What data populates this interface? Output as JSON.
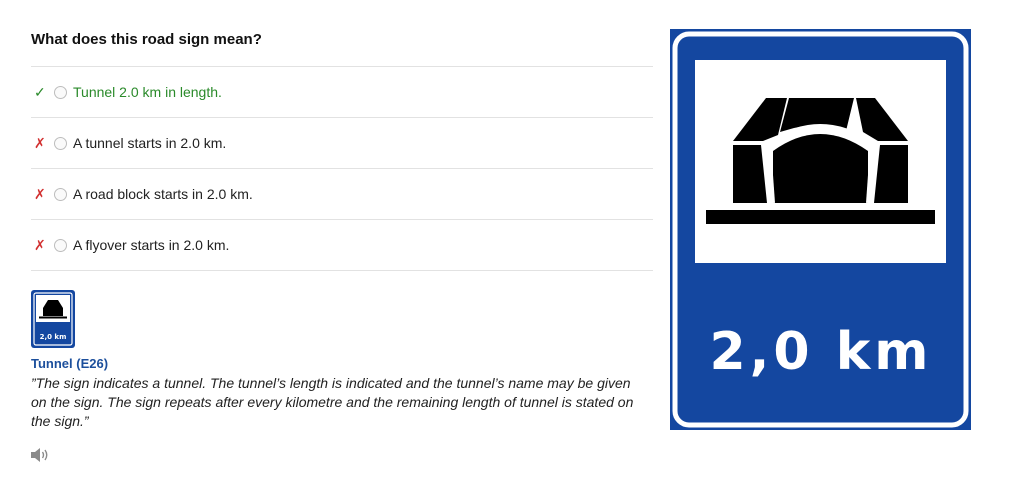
{
  "question": "What does this road sign mean?",
  "answers": [
    {
      "text": "Tunnel 2.0 km in length.",
      "status": "correct",
      "mark": "✓"
    },
    {
      "text": "A tunnel starts in 2.0 km.",
      "status": "wrong",
      "mark": "✗"
    },
    {
      "text": "A road block starts in 2.0 km.",
      "status": "wrong",
      "mark": "✗"
    },
    {
      "text": "A flyover starts in 2.0 km.",
      "status": "wrong",
      "mark": "✗"
    }
  ],
  "explanation": {
    "title": "Tunnel (E26)",
    "text": "”The sign indicates a tunnel. The tunnel’s length is indicated and the tunnel’s name may be given on the sign. The sign repeats after every kilometre and the remaining length of tunnel is stated on the sign.”",
    "audio_icon": "speaker-icon"
  },
  "sign": {
    "distance_label": "2,0 km",
    "thumbnail_label": "2,0 km",
    "colors": {
      "blue": "#1447a0",
      "white": "#ffffff",
      "black": "#000000"
    }
  },
  "colors": {
    "correct": "#2a8a2a",
    "wrong": "#d23030",
    "link_title": "#1c4f9c"
  }
}
